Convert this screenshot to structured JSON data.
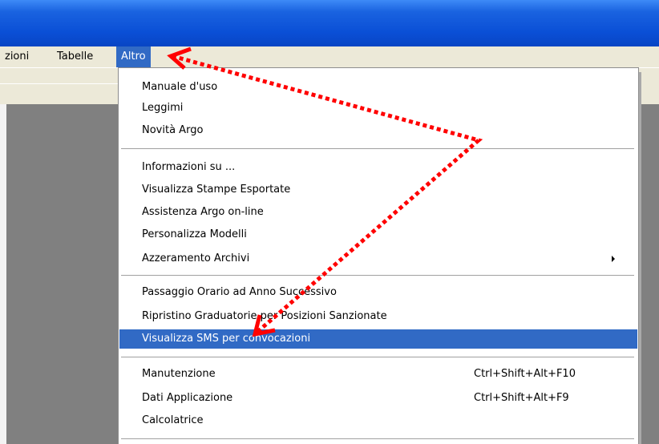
{
  "menubar": {
    "items": [
      {
        "label": "zioni"
      },
      {
        "label": "Tabelle"
      },
      {
        "label": "Altro"
      }
    ]
  },
  "menu": {
    "group1": [
      "Manuale d'uso",
      "Leggimi",
      "Novità Argo"
    ],
    "group2": [
      "Informazioni su ...",
      "Visualizza Stampe Esportate",
      "Assistenza Argo on-line",
      "Personalizza Modelli",
      "Azzeramento Archivi"
    ],
    "group3": [
      "Passaggio Orario ad Anno Successivo",
      "Ripristino Graduatorie per Posizioni Sanzionate",
      "Visualizza SMS per convocazioni"
    ],
    "group4": [
      {
        "label": "Manutenzione",
        "shortcut": "Ctrl+Shift+Alt+F10"
      },
      {
        "label": "Dati Applicazione",
        "shortcut": "Ctrl+Shift+Alt+F9"
      },
      {
        "label": "Calcolatrice",
        "shortcut": ""
      }
    ]
  },
  "colors": {
    "titlebar": "#0a4fd6",
    "menu_highlight": "#316ac5",
    "annotation": "#ff0000",
    "workspace": "#808080"
  }
}
